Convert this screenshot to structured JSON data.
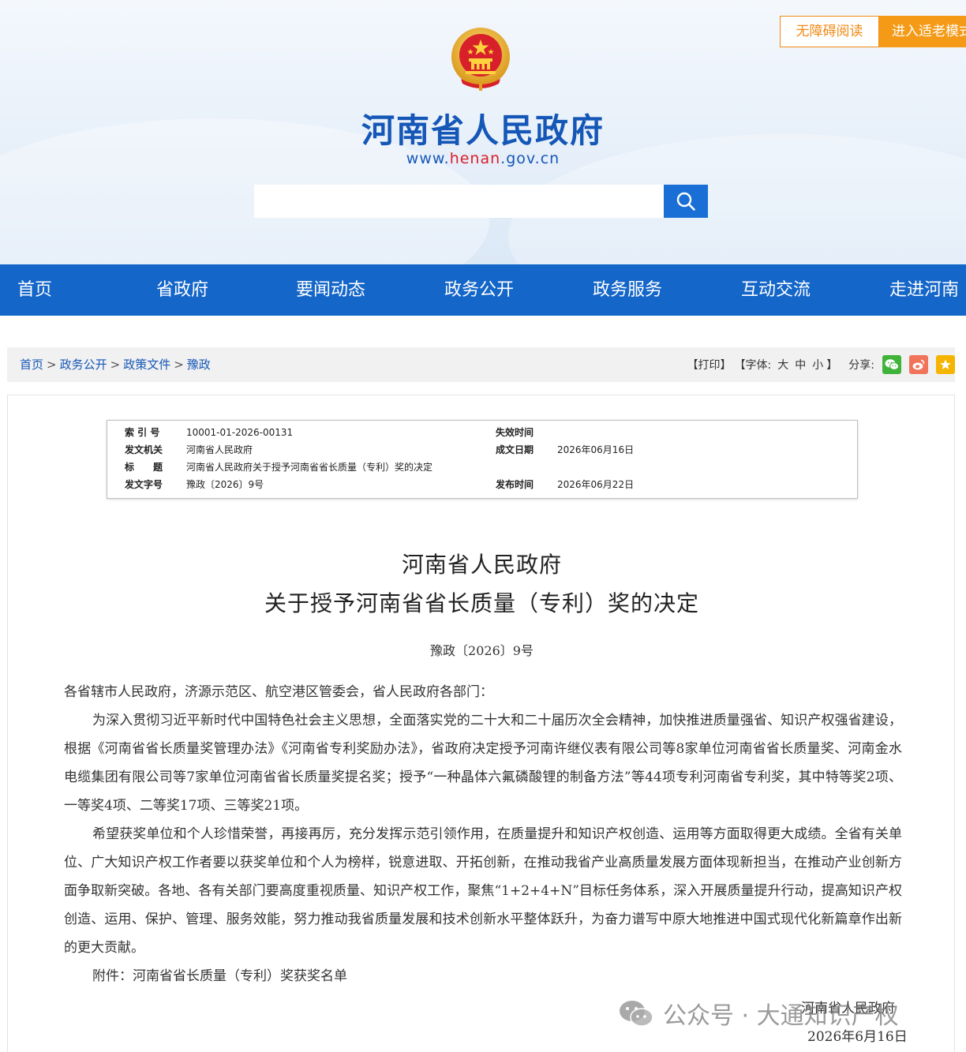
{
  "header": {
    "accessibility_label": "无障碍阅读",
    "elder_mode_label": "进入适老模式",
    "site_title": "河南省人民政府",
    "site_url_prefix": "www.",
    "site_url_domain": "henan",
    "site_url_suffix": ".gov.cn",
    "search_placeholder": ""
  },
  "nav": {
    "items": [
      {
        "label": "首页"
      },
      {
        "label": "省政府"
      },
      {
        "label": "要闻动态"
      },
      {
        "label": "政务公开"
      },
      {
        "label": "政务服务"
      },
      {
        "label": "互动交流"
      },
      {
        "label": "走进河南"
      }
    ]
  },
  "breadcrumb": {
    "items": [
      "首页",
      "政务公开",
      "政策文件",
      "豫政"
    ],
    "separator": ">"
  },
  "tools": {
    "print": "【打印】",
    "font_label": "【字体:",
    "font_large": "大",
    "font_medium": "中",
    "font_small": "小",
    "font_end": "】",
    "share_label": "分享:"
  },
  "meta": {
    "index_key": "索 引 号",
    "index_value": "10001-01-2026-00131",
    "issuer_key": "发文机关",
    "issuer_value": "河南省人民政府",
    "title_key": "标　　题",
    "title_value": "河南省人民政府关于授予河南省省长质量（专利）奖的决定",
    "docno_key": "发文字号",
    "docno_value": "豫政〔2026〕9号",
    "expiry_key": "失效时间",
    "expiry_value": "",
    "created_key": "成文日期",
    "created_value": "2026年06月16日",
    "published_key": "发布时间",
    "published_value": "2026年06月22日"
  },
  "document": {
    "title_line1": "河南省人民政府",
    "title_line2": "关于授予河南省省长质量（专利）奖的决定",
    "doc_number": "豫政〔2026〕9号",
    "salutation": "各省辖市人民政府，济源示范区、航空港区管委会，省人民政府各部门：",
    "paragraph1": "为深入贯彻习近平新时代中国特色社会主义思想，全面落实党的二十大和二十届历次全会精神，加快推进质量强省、知识产权强省建设，根据《河南省省长质量奖管理办法》《河南省专利奖励办法》，省政府决定授予河南许继仪表有限公司等8家单位河南省省长质量奖、河南金水电缆集团有限公司等7家单位河南省省长质量奖提名奖；授予“一种晶体六氟磷酸锂的制备方法”等44项专利河南省专利奖，其中特等奖2项、一等奖4项、二等奖17项、三等奖21项。",
    "paragraph2": "希望获奖单位和个人珍惜荣誉，再接再厉，充分发挥示范引领作用，在质量提升和知识产权创造、运用等方面取得更大成绩。全省有关单位、广大知识产权工作者要以获奖单位和个人为榜样，锐意进取、开拓创新，在推动我省产业高质量发展方面体现新担当，在推动产业创新方面争取新突破。各地、各有关部门要高度重视质量、知识产权工作，聚焦“1+2+4+N”目标任务体系，深入开展质量提升行动，提高知识产权创造、运用、保护、管理、服务效能，努力推动我省质量发展和技术创新水平整体跃升，为奋力谱写中原大地推进中国式现代化新篇章作出新的更大贡献。",
    "attachment": "附件：河南省省长质量（专利）奖获奖名单",
    "signer": "河南省人民政府",
    "sign_date": "2026年6月16日"
  },
  "watermark": {
    "text": "公众号 · 大通知识产权"
  },
  "colors": {
    "brand_blue": "#1466c9",
    "title_blue": "#1557b7",
    "accent_orange": "#f59a16",
    "wechat_green": "#3fb33a",
    "weibo_orange": "#f0735a",
    "favorite_yellow": "#f5b400"
  }
}
